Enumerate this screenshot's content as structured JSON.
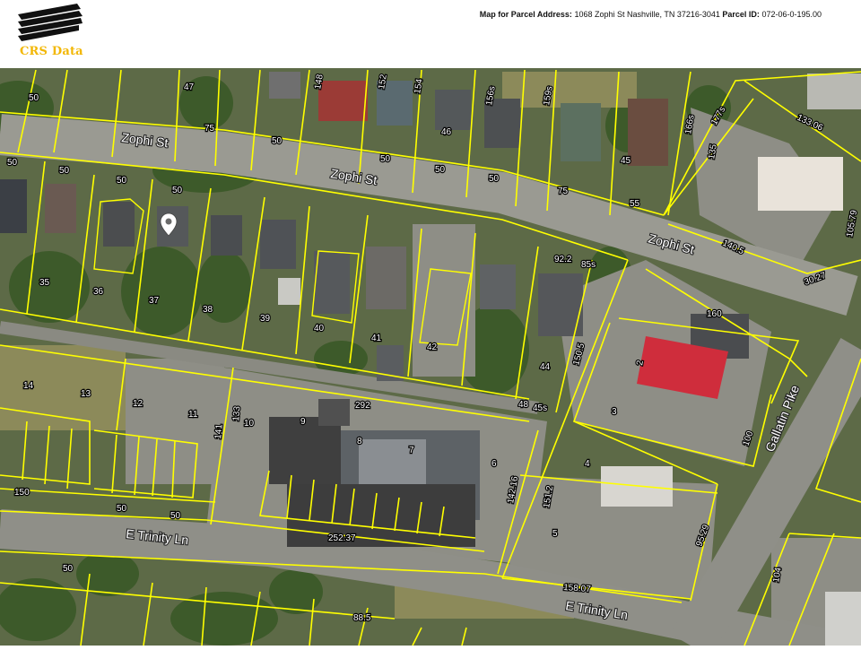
{
  "header": {
    "brand": "CRS Data",
    "address_label": "Map for Parcel Address:",
    "address": "1068 Zophi St Nashville, TN 37216-3041",
    "parcel_label": "Parcel ID:",
    "parcel_id": "072-06-0-195.00"
  },
  "colors": {
    "parcel_line": "#ffff00",
    "logo_accent": "#f2b705",
    "pin": "#ffffff"
  },
  "icons": {
    "marker": "map-pin-icon",
    "logo": "crs-logo-icon"
  },
  "streets": [
    {
      "id": "zophi-a",
      "label": "Zophi St"
    },
    {
      "id": "zophi-b",
      "label": "Zophi St"
    },
    {
      "id": "zophi-c",
      "label": "Zophi St"
    },
    {
      "id": "trinity-a",
      "label": "E Trinity Ln"
    },
    {
      "id": "trinity-b",
      "label": "E Trinity Ln"
    },
    {
      "id": "gallatin",
      "label": "Gallatin Pike"
    }
  ],
  "parcel_labels": [
    "50",
    "47",
    "148",
    "152",
    "154",
    "156s",
    "159s",
    "166s",
    "177s",
    "135",
    "133.06",
    "75",
    "50",
    "50",
    "46",
    "50",
    "45",
    "75",
    "55",
    "50",
    "50",
    "50",
    "50",
    "50",
    "140.5",
    "105.79",
    "30.27",
    "35",
    "36",
    "37",
    "38",
    "39",
    "40",
    "41",
    "42",
    "44",
    "92.2",
    "85s",
    "150.5",
    "48",
    "45s",
    "160",
    "2",
    "14",
    "13",
    "12",
    "11",
    "133",
    "141",
    "10",
    "9",
    "8",
    "7",
    "6",
    "292",
    "3",
    "100",
    "4",
    "142.16",
    "151.2",
    "150",
    "50",
    "50",
    "252.37",
    "5",
    "95.29",
    "158.07",
    "104",
    "50",
    "88.5"
  ]
}
